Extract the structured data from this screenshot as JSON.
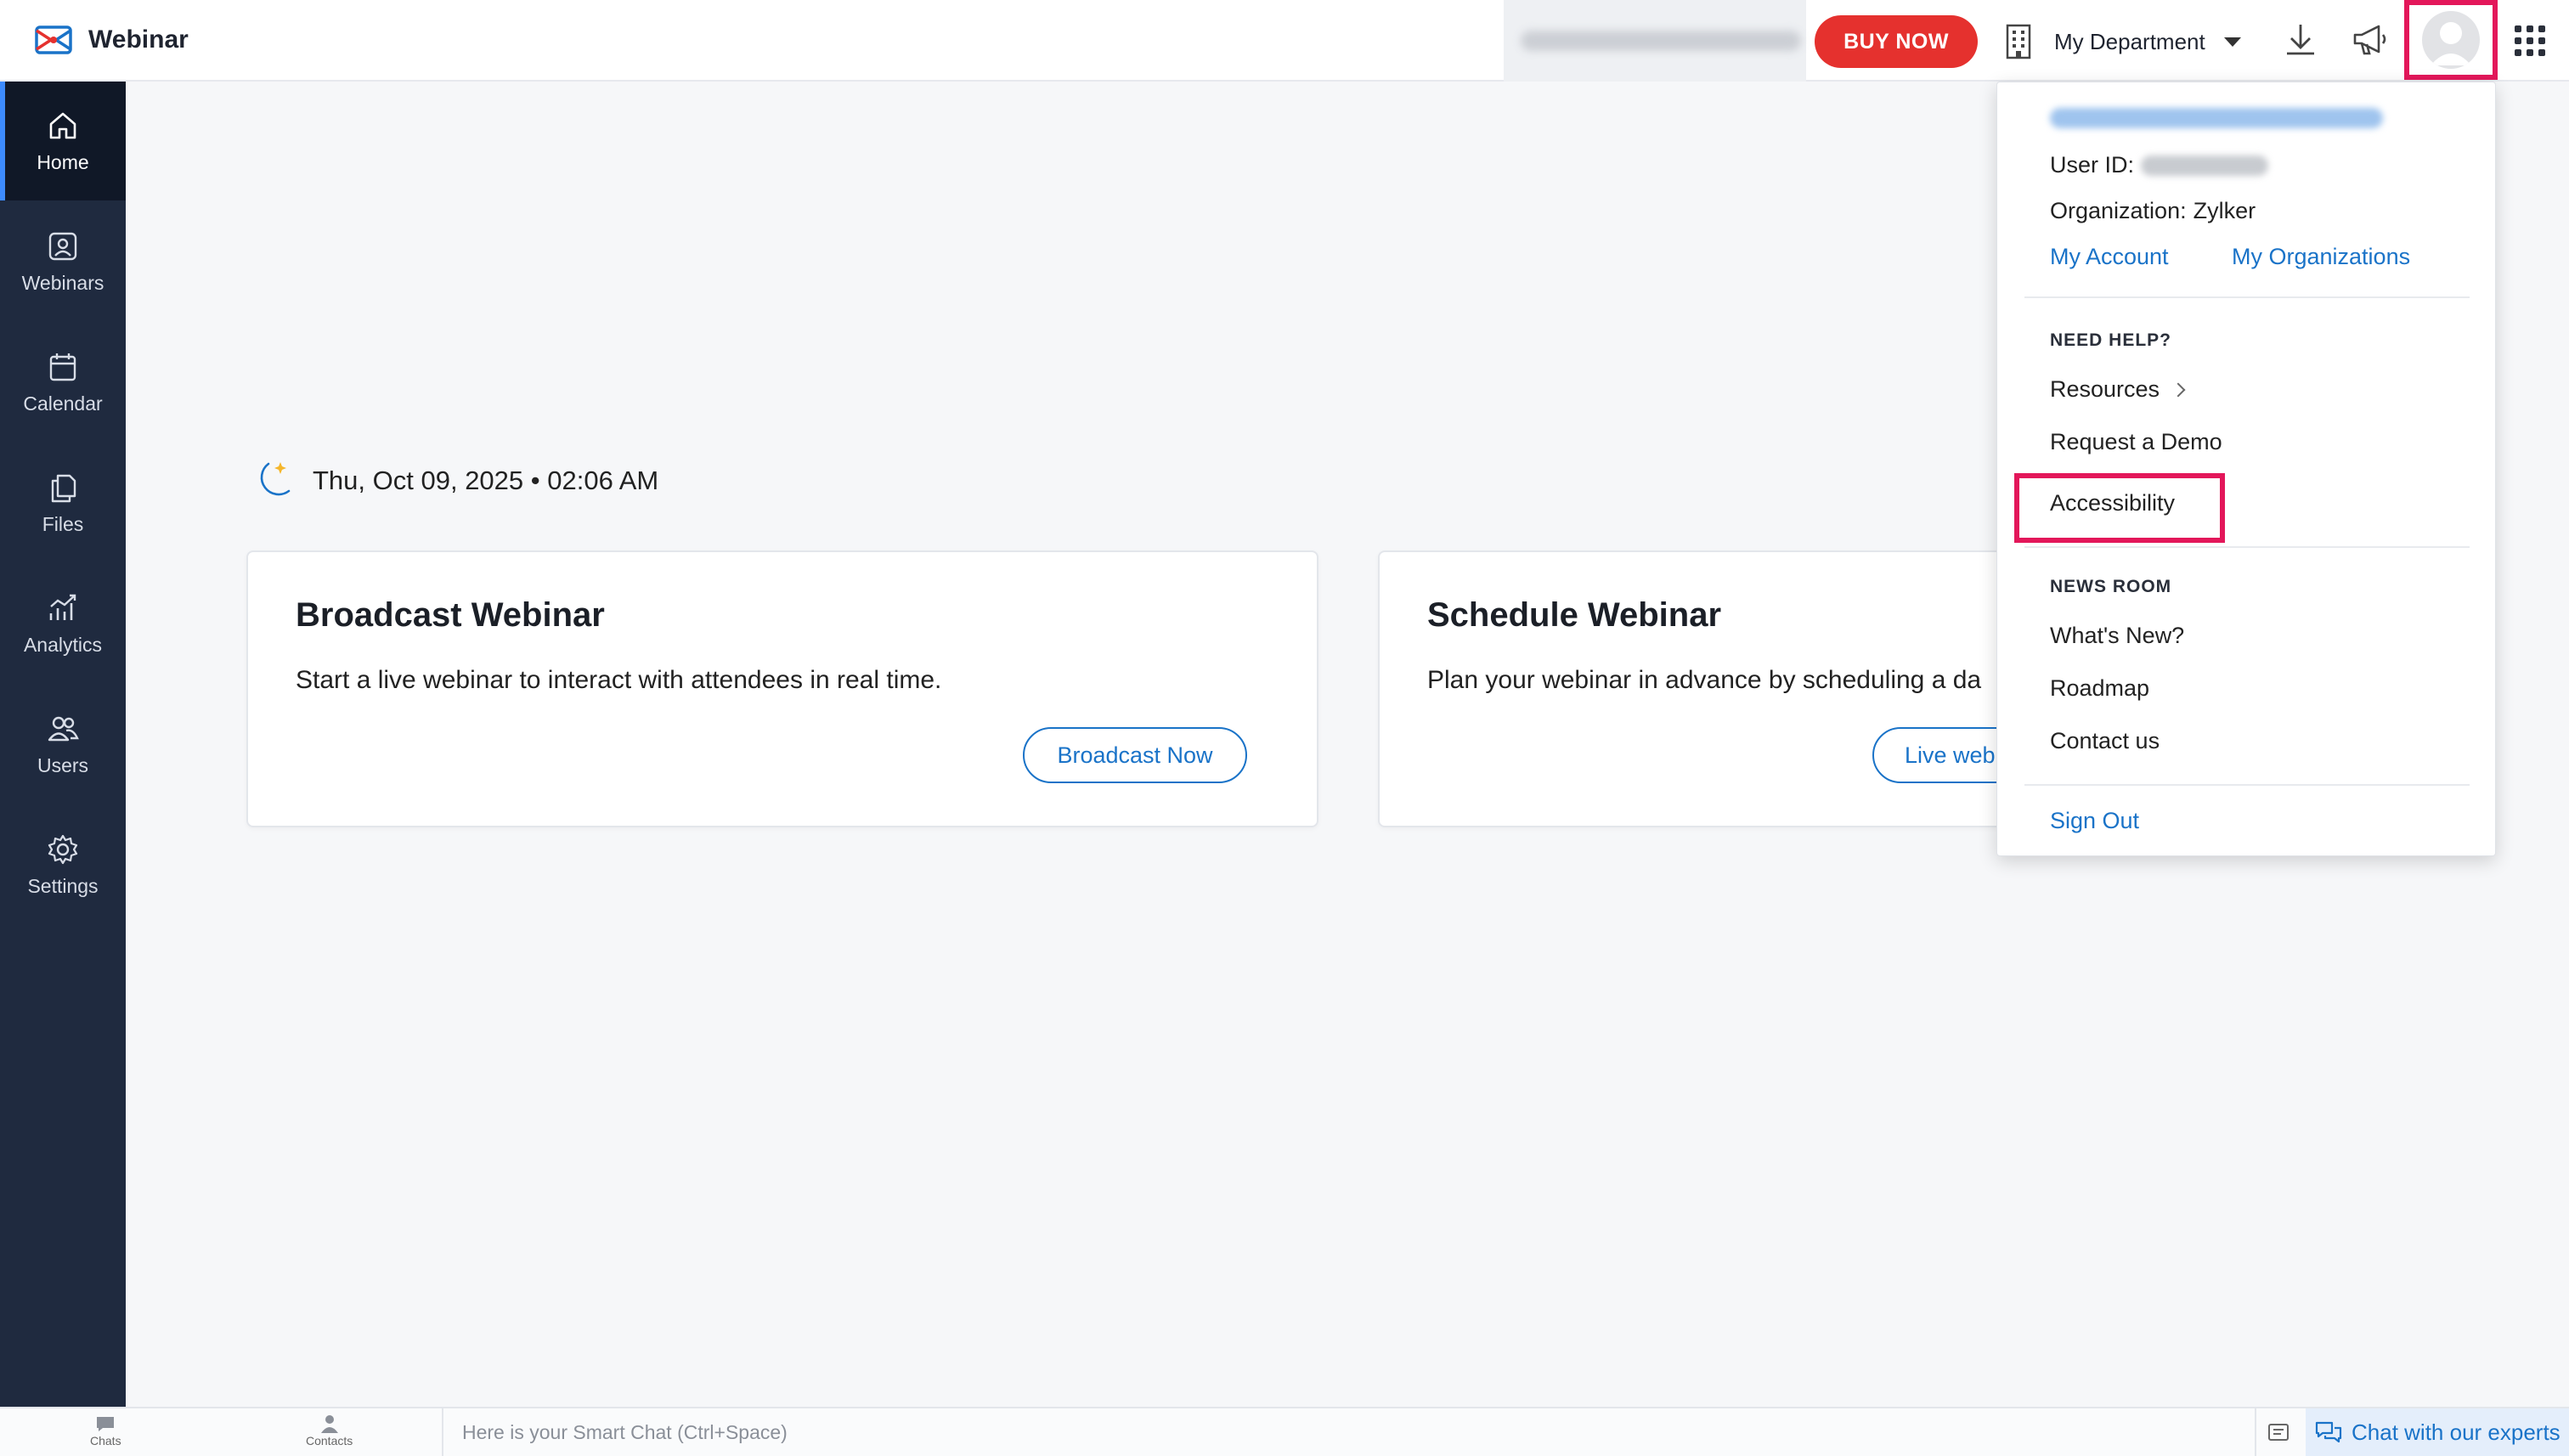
{
  "app": {
    "name": "Webinar"
  },
  "topbar": {
    "buy_now_label": "BUY NOW",
    "department_label": "My Department",
    "icons": [
      "building-icon",
      "download-icon",
      "megaphone-icon",
      "avatar",
      "apps-grid-icon"
    ]
  },
  "sidebar": {
    "items": [
      {
        "label": "Home",
        "icon": "home-icon",
        "active": true
      },
      {
        "label": "Webinars",
        "icon": "webinar-icon",
        "active": false
      },
      {
        "label": "Calendar",
        "icon": "calendar-icon",
        "active": false
      },
      {
        "label": "Files",
        "icon": "files-icon",
        "active": false
      },
      {
        "label": "Analytics",
        "icon": "analytics-icon",
        "active": false
      },
      {
        "label": "Users",
        "icon": "users-icon",
        "active": false
      },
      {
        "label": "Settings",
        "icon": "gear-icon",
        "active": false
      }
    ]
  },
  "main": {
    "greeting_datetime": "Thu, Oct 09, 2025 • 02:06 AM",
    "cards": [
      {
        "title": "Broadcast Webinar",
        "description": "Start a live webinar to interact with attendees in real time.",
        "button": "Broadcast Now"
      },
      {
        "title": "Schedule Webinar",
        "description": "Plan your webinar in advance by scheduling a da",
        "button": "Live web"
      }
    ]
  },
  "profile_menu": {
    "user_id_label": "User ID:",
    "organization_label": "Organization:",
    "organization_value": "Zylker",
    "my_account": "My Account",
    "my_organizations": "My Organizations",
    "need_help_heading": "NEED HELP?",
    "resources": "Resources",
    "request_demo": "Request a Demo",
    "accessibility": "Accessibility",
    "news_room_heading": "NEWS ROOM",
    "whats_new": "What's New?",
    "roadmap": "Roadmap",
    "contact_us": "Contact us",
    "sign_out": "Sign Out"
  },
  "bottombar": {
    "chats_label": "Chats",
    "contacts_label": "Contacts",
    "smart_chat_placeholder": "Here is your Smart Chat (Ctrl+Space)",
    "expert_chat_label": "Chat with our experts"
  },
  "colors": {
    "accent_blue": "#1a73c8",
    "buy_now_red": "#e5312e",
    "sidebar_bg": "#1f2a3f",
    "highlight_pink": "#e3175a"
  }
}
